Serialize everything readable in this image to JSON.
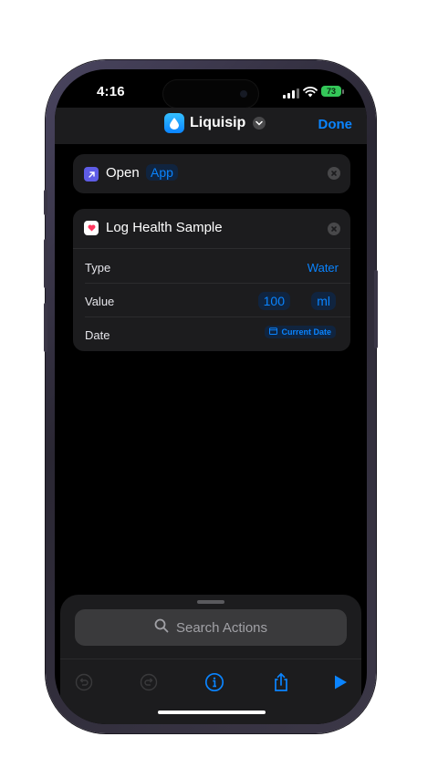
{
  "status_bar": {
    "time": "4:16",
    "battery": "73"
  },
  "nav": {
    "app_name": "Liquisip",
    "done_label": "Done"
  },
  "actions": [
    {
      "title": "Open",
      "param": "App"
    },
    {
      "title": "Log Health Sample",
      "rows": [
        {
          "label": "Type",
          "value": "Water"
        },
        {
          "label": "Value",
          "amount": "100",
          "unit": "ml"
        },
        {
          "label": "Date",
          "value": "Current Date"
        }
      ]
    }
  ],
  "bottom_sheet": {
    "search_placeholder": "Search Actions"
  },
  "icons": {
    "toolbar": [
      "undo-icon",
      "redo-icon",
      "info-icon",
      "share-icon",
      "play-icon"
    ],
    "open": "arrow-up-right-icon",
    "health": "heart-icon"
  },
  "colors": {
    "accent": "#0a84ff",
    "background": "#000000",
    "card": "#1c1c1e",
    "battery": "#34c759"
  }
}
